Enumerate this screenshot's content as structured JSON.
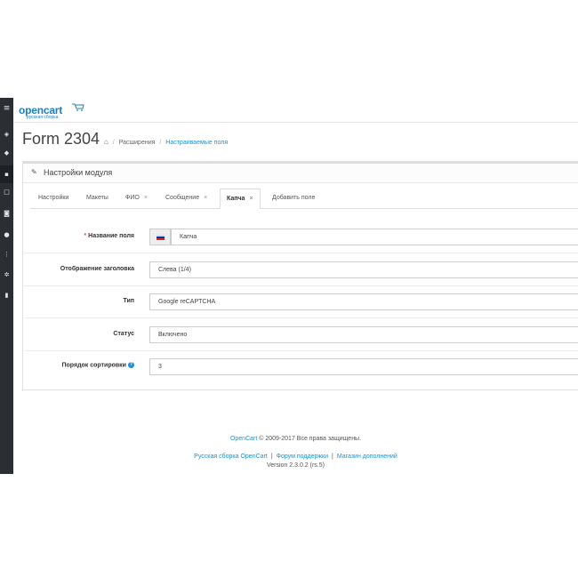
{
  "colors": {
    "sidebar_bg": "#2b2f33",
    "brand_blue": "#1d7fc1",
    "link_blue": "#1e91cf",
    "required_red": "#d9534f"
  },
  "sidebar": {
    "icons": [
      "menu-icon",
      "dashboard-icon",
      "tag-icon",
      "puzzle-icon",
      "desktop-icon",
      "cart-icon",
      "user-icon",
      "share-icon",
      "settings-icon",
      "chart-icon"
    ]
  },
  "header": {
    "logo_text": "opencart",
    "logo_subtext": "русская сборка"
  },
  "page": {
    "title": "Form 2304",
    "breadcrumb": {
      "items": [
        "Расширения",
        "Настраиваемые поля"
      ]
    }
  },
  "panel": {
    "title": "Настройки модуля",
    "tabs": [
      {
        "label": "Настройки",
        "closable": false
      },
      {
        "label": "Макеты",
        "closable": false
      },
      {
        "label": "ФИО",
        "closable": true
      },
      {
        "label": "Сообщение",
        "closable": true
      },
      {
        "label": "Капча",
        "closable": true,
        "active": true
      },
      {
        "label": "Добавить поле",
        "closable": false
      }
    ],
    "tab_close_symbol": "×",
    "fields": [
      {
        "label": "Название поля",
        "required": true,
        "value": "Капча",
        "has_flag": true
      },
      {
        "label": "Отображение заголовка",
        "required": false,
        "value": "Слева (1/4)",
        "type": "select"
      },
      {
        "label": "Тип",
        "required": false,
        "value": "Google reCAPTCHA",
        "type": "select"
      },
      {
        "label": "Статус",
        "required": false,
        "value": "Включено",
        "type": "select"
      },
      {
        "label": "Порядок сортировки",
        "required": false,
        "value": "3",
        "has_help": true
      }
    ]
  },
  "footer": {
    "brand_link": "OpenCart",
    "copyright": "© 2009-2017 Все права защищены.",
    "links": [
      "Русская сборка OpenCart",
      "Форум поддержки",
      "Магазин дополнений"
    ],
    "version": "Version 2.3.0.2 (rs.5)"
  }
}
